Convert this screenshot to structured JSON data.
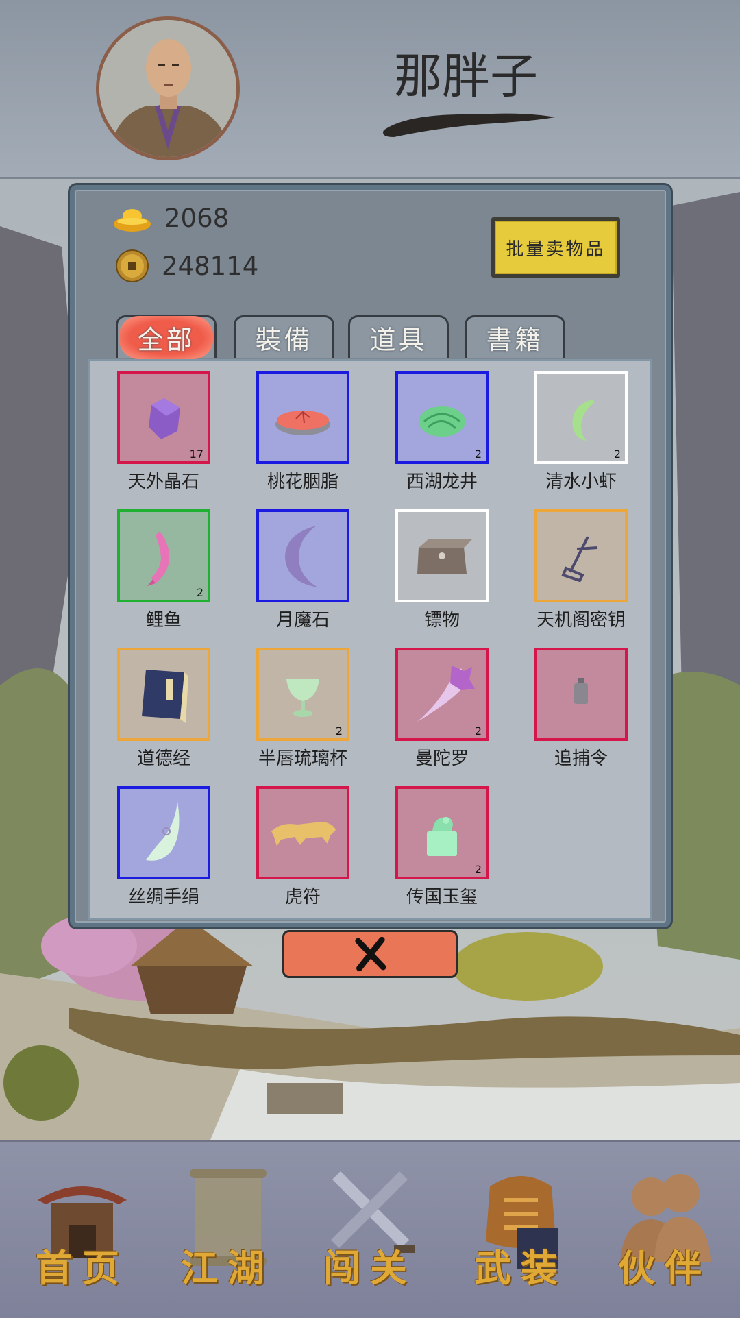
{
  "player": {
    "name": "那胖子"
  },
  "currency": {
    "gold_ingot": {
      "icon": "gold-ingot-icon",
      "value": "2068"
    },
    "copper_coin": {
      "icon": "copper-coin-icon",
      "value": "248114"
    }
  },
  "sell_button_label": "批量卖物品",
  "tabs": [
    {
      "label": "全部",
      "active": true
    },
    {
      "label": "裝備",
      "active": false
    },
    {
      "label": "道具",
      "active": false
    },
    {
      "label": "書籍",
      "active": false
    }
  ],
  "items": [
    {
      "name": "天外晶石",
      "count": "17",
      "quality": "red",
      "icon": "crystal-icon"
    },
    {
      "name": "桃花胭脂",
      "count": "",
      "quality": "blue",
      "icon": "rouge-icon"
    },
    {
      "name": "西湖龙井",
      "count": "2",
      "quality": "blue",
      "icon": "tea-leaves-icon"
    },
    {
      "name": "清水小虾",
      "count": "2",
      "quality": "white",
      "icon": "shrimp-icon"
    },
    {
      "name": "鲤鱼",
      "count": "2",
      "quality": "green",
      "icon": "carp-icon"
    },
    {
      "name": "月魔石",
      "count": "",
      "quality": "blue",
      "icon": "moon-stone-icon"
    },
    {
      "name": "镖物",
      "count": "",
      "quality": "white",
      "icon": "escort-box-icon"
    },
    {
      "name": "天机阁密钥",
      "count": "",
      "quality": "orange",
      "icon": "secret-key-icon"
    },
    {
      "name": "道德经",
      "count": "",
      "quality": "orange",
      "icon": "book-icon"
    },
    {
      "name": "半唇琉璃杯",
      "count": "2",
      "quality": "orange",
      "icon": "glass-cup-icon"
    },
    {
      "name": "曼陀罗",
      "count": "2",
      "quality": "red",
      "icon": "datura-flower-icon"
    },
    {
      "name": "追捕令",
      "count": "",
      "quality": "red",
      "icon": "arrest-token-icon"
    },
    {
      "name": "丝绸手绢",
      "count": "",
      "quality": "blue",
      "icon": "silk-handkerchief-icon"
    },
    {
      "name": "虎符",
      "count": "",
      "quality": "red",
      "icon": "tiger-tally-icon"
    },
    {
      "name": "传国玉玺",
      "count": "2",
      "quality": "red",
      "icon": "jade-seal-icon"
    }
  ],
  "nav": [
    {
      "label": "首页",
      "icon": "home-pavilion-icon"
    },
    {
      "label": "江湖",
      "icon": "scroll-icon"
    },
    {
      "label": "闯关",
      "icon": "crossed-swords-icon"
    },
    {
      "label": "武装",
      "icon": "armor-icon"
    },
    {
      "label": "伙伴",
      "icon": "companions-icon"
    }
  ],
  "colors": {
    "quality_red": "#d4164a",
    "quality_blue": "#1a1ae0",
    "quality_white": "#ffffff",
    "quality_green": "#1fb032",
    "quality_orange": "#eda63a",
    "active_tab": "#f05c4a",
    "close_button": "#ea7658",
    "nav_label": "#e0a935"
  }
}
